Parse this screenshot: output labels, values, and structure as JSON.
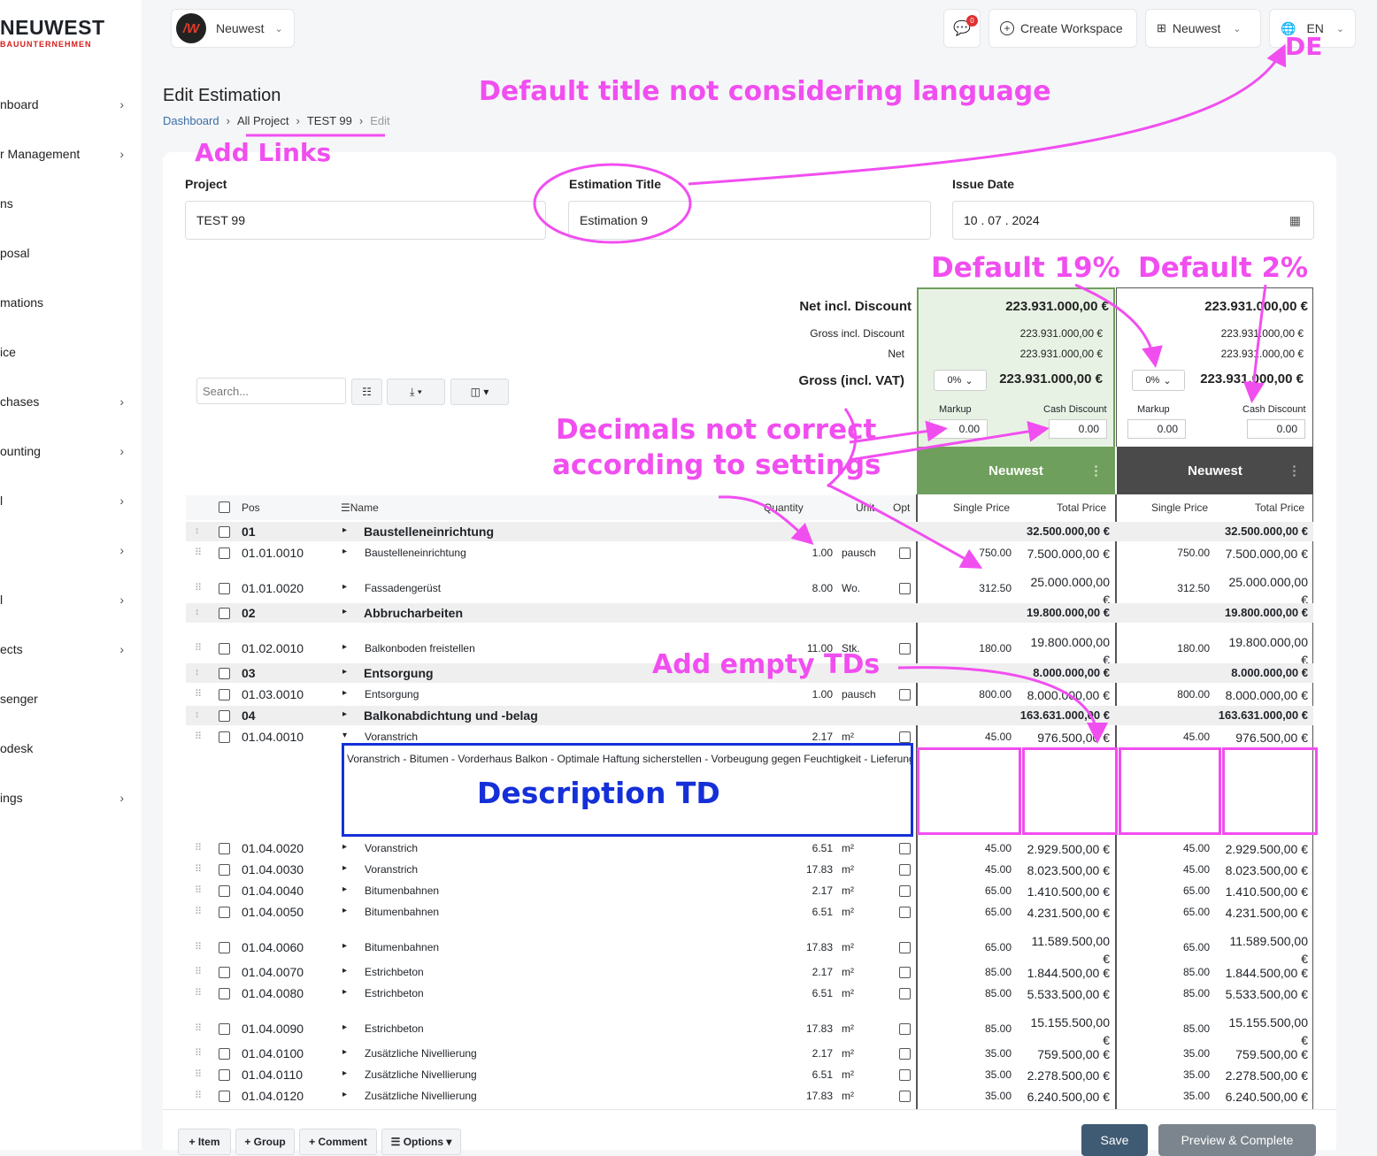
{
  "brand": {
    "name": "NEUWEST",
    "sub": "BAUUNTERNEHMEN"
  },
  "sidebar": [
    "nboard",
    "r Management",
    "ns",
    "posal",
    "mations",
    "ice",
    "chases",
    "ounting",
    "l",
    "",
    "l",
    "ects",
    "senger",
    "odesk",
    "ings"
  ],
  "topbar": {
    "org": "Neuwest",
    "notif_count": "0",
    "create_ws": "Create Workspace",
    "workspace": "Neuwest",
    "lang": "EN"
  },
  "page": {
    "title": "Edit Estimation",
    "breadcrumb": [
      "Dashboard",
      "All Project",
      "TEST 99",
      "Edit"
    ]
  },
  "form": {
    "project_label": "Project",
    "project_value": "TEST 99",
    "title_label": "Estimation Title",
    "title_value": "Estimation 9",
    "date_label": "Issue Date",
    "date_value": "10 . 07 . 2024"
  },
  "summary": {
    "labels": [
      "Net incl. Discount",
      "Gross incl. Discount",
      "Net",
      "Gross (incl. VAT)"
    ],
    "col1": {
      "net_disc": "223.931.000,00 €",
      "gross_disc": "223.931.000,00 €",
      "net": "223.931.000,00 €",
      "gross": "223.931.000,00 €",
      "vat": "0%",
      "markup_label": "Markup",
      "markup": "0.00",
      "cash_label": "Cash Discount",
      "cash": "0.00",
      "name": "Neuwest"
    },
    "col2": {
      "net_disc": "223.931.000,00 €",
      "gross_disc": "223.931.000,00 €",
      "net": "223.931.000,00 €",
      "gross": "223.931.000,00 €",
      "vat": "0%",
      "markup_label": "Markup",
      "markup": "0.00",
      "cash_label": "Cash Discount",
      "cash": "0.00",
      "name": "Neuwest"
    }
  },
  "toolbar": {
    "search_placeholder": "Search..."
  },
  "columns": {
    "pos": "Pos",
    "name": "Name",
    "qty": "Quantity",
    "unit": "Unit",
    "opt": "Opt",
    "single": "Single Price",
    "total": "Total Price"
  },
  "rows": [
    {
      "g": 1,
      "pos": "01",
      "name": "Baustelleneinrichtung",
      "total": "32.500.000,00 €"
    },
    {
      "g": 0,
      "pos": "01.01.0010",
      "name": "Baustelleneinrichtung",
      "qty": "1.00",
      "unit": "pausch",
      "sp": "750.00",
      "tp": "7.500.000,00 €"
    },
    {
      "g": 0,
      "pos": "01.01.0020",
      "name": "Fassadengerüst",
      "qty": "8.00",
      "unit": "Wo.",
      "sp": "312.50",
      "tp": "25.000.000,00",
      "tp2": "€"
    },
    {
      "g": 1,
      "pos": "02",
      "name": "Abbrucharbeiten",
      "total": "19.800.000,00 €"
    },
    {
      "g": 0,
      "pos": "01.02.0010",
      "name": "Balkonboden freistellen",
      "qty": "11.00",
      "unit": "Stk.",
      "sp": "180.00",
      "tp": "19.800.000,00",
      "tp2": "€"
    },
    {
      "g": 1,
      "pos": "03",
      "name": "Entsorgung",
      "total": "8.000.000,00 €"
    },
    {
      "g": 0,
      "pos": "01.03.0010",
      "name": "Entsorgung",
      "qty": "1.00",
      "unit": "pausch",
      "sp": "800.00",
      "tp": "8.000.000,00 €"
    },
    {
      "g": 1,
      "pos": "04",
      "name": "Balkonabdichtung und -belag",
      "total": "163.631.000,00 €"
    },
    {
      "g": 0,
      "pos": "01.04.0010",
      "name": "Voranstrich",
      "qty": "2.17",
      "unit": "m²",
      "sp": "45.00",
      "tp": "976.500,00 €"
    },
    {
      "g": 0,
      "pos": "01.04.0020",
      "name": "Voranstrich",
      "qty": "6.51",
      "unit": "m²",
      "sp": "45.00",
      "tp": "2.929.500,00 €"
    },
    {
      "g": 0,
      "pos": "01.04.0030",
      "name": "Voranstrich",
      "qty": "17.83",
      "unit": "m²",
      "sp": "45.00",
      "tp": "8.023.500,00 €"
    },
    {
      "g": 0,
      "pos": "01.04.0040",
      "name": "Bitumenbahnen",
      "qty": "2.17",
      "unit": "m²",
      "sp": "65.00",
      "tp": "1.410.500,00 €"
    },
    {
      "g": 0,
      "pos": "01.04.0050",
      "name": "Bitumenbahnen",
      "qty": "6.51",
      "unit": "m²",
      "sp": "65.00",
      "tp": "4.231.500,00 €"
    },
    {
      "g": 0,
      "pos": "01.04.0060",
      "name": "Bitumenbahnen",
      "qty": "17.83",
      "unit": "m²",
      "sp": "65.00",
      "tp": "11.589.500,00",
      "tp2": "€"
    },
    {
      "g": 0,
      "pos": "01.04.0070",
      "name": "Estrichbeton",
      "qty": "2.17",
      "unit": "m²",
      "sp": "85.00",
      "tp": "1.844.500,00 €"
    },
    {
      "g": 0,
      "pos": "01.04.0080",
      "name": "Estrichbeton",
      "qty": "6.51",
      "unit": "m²",
      "sp": "85.00",
      "tp": "5.533.500,00 €"
    },
    {
      "g": 0,
      "pos": "01.04.0090",
      "name": "Estrichbeton",
      "qty": "17.83",
      "unit": "m²",
      "sp": "85.00",
      "tp": "15.155.500,00",
      "tp2": "€"
    },
    {
      "g": 0,
      "pos": "01.04.0100",
      "name": "Zusätzliche Nivellierung",
      "qty": "2.17",
      "unit": "m²",
      "sp": "35.00",
      "tp": "759.500,00 €"
    },
    {
      "g": 0,
      "pos": "01.04.0110",
      "name": "Zusätzliche Nivellierung",
      "qty": "6.51",
      "unit": "m²",
      "sp": "35.00",
      "tp": "2.278.500,00 €"
    },
    {
      "g": 0,
      "pos": "01.04.0120",
      "name": "Zusätzliche Nivellierung",
      "qty": "17.83",
      "unit": "m²",
      "sp": "35.00",
      "tp": "6.240.500,00 €"
    }
  ],
  "description": "Voranstrich - Bitumen - Vorderhaus Balkon - Optimale Haftung sicherstellen - Vorbeugung gegen Feuchtigkeit - Lieferung und Montage",
  "bottom": {
    "item": "+ Item",
    "group": "+ Group",
    "comment": "+ Comment",
    "options": "☰ Options ▾",
    "save": "Save",
    "preview": "Preview & Complete"
  },
  "annotations": {
    "de": "DE",
    "title_lang": "Default title not considering language",
    "links": "Add Links",
    "vat19": "Default 19%",
    "disc2": "Default 2%",
    "decimals1": "Decimals not correct",
    "decimals2": "according to settings",
    "empty_tds": "Add empty TDs",
    "desc_td": "Description TD"
  },
  "colors": {
    "accent_green": "#6f9f5c",
    "dark_header": "#4a4a4a",
    "annotation": "#f14ef0",
    "desc_box": "#1530d8",
    "save": "#3f5a73"
  }
}
